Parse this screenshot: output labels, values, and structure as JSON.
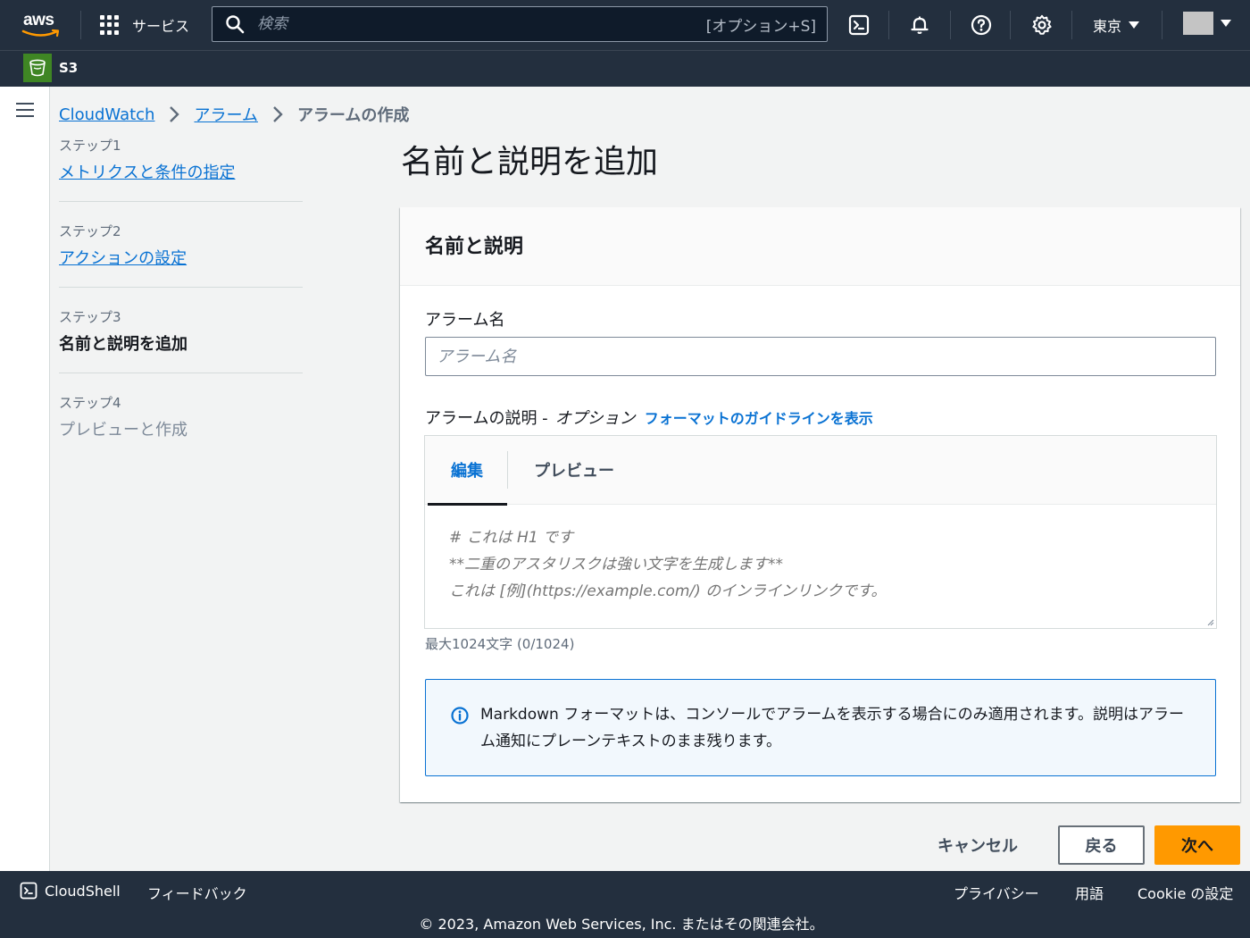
{
  "topnav": {
    "logo_text": "aws",
    "services_label": "サービス",
    "search_placeholder": "検索",
    "search_shortcut": "[オプション+S]",
    "region": "東京",
    "favorite_service": "S3",
    "icons": [
      "cloudshell-icon",
      "bell-icon",
      "help-icon",
      "gear-icon"
    ]
  },
  "breadcrumb": {
    "items": [
      "CloudWatch",
      "アラーム"
    ],
    "current": "アラームの作成"
  },
  "steps": [
    {
      "num": "ステップ1",
      "label": "メトリクスと条件の指定",
      "state": "link"
    },
    {
      "num": "ステップ2",
      "label": "アクションの設定",
      "state": "link"
    },
    {
      "num": "ステップ3",
      "label": "名前と説明を追加",
      "state": "active"
    },
    {
      "num": "ステップ4",
      "label": "プレビューと作成",
      "state": "disabled"
    }
  ],
  "page": {
    "title": "名前と説明を追加"
  },
  "panel": {
    "header": "名前と説明",
    "name_label": "アラーム名",
    "name_placeholder": "アラーム名",
    "name_value": "",
    "desc_label": "アラームの説明 -",
    "desc_optional": "オプション",
    "desc_guideline_link": "フォーマットのガイドラインを表示",
    "tab_edit": "編集",
    "tab_preview": "プレビュー",
    "desc_placeholder": "# これは H1 です\n**二重のアスタリスクは強い文字を生成します**\nこれは [例](https://example.com/) のインラインリンクです。",
    "char_hint": "最大1024文字 (0/1024)",
    "info_message": "Markdown フォーマットは、コンソールでアラームを表示する場合にのみ適用されます。説明はアラーム通知にプレーンテキストのまま残ります。"
  },
  "actions": {
    "cancel": "キャンセル",
    "back": "戻る",
    "next": "次へ"
  },
  "footer": {
    "cloudshell": "CloudShell",
    "feedback": "フィードバック",
    "privacy": "プライバシー",
    "terms": "用語",
    "cookie": "Cookie の設定",
    "copyright": "© 2023, Amazon Web Services, Inc. またはその関連会社。"
  },
  "colors": {
    "nav_bg": "#232f3e",
    "link": "#0972d3",
    "primary_button": "#ff9900",
    "s3_green": "#3f8624"
  }
}
